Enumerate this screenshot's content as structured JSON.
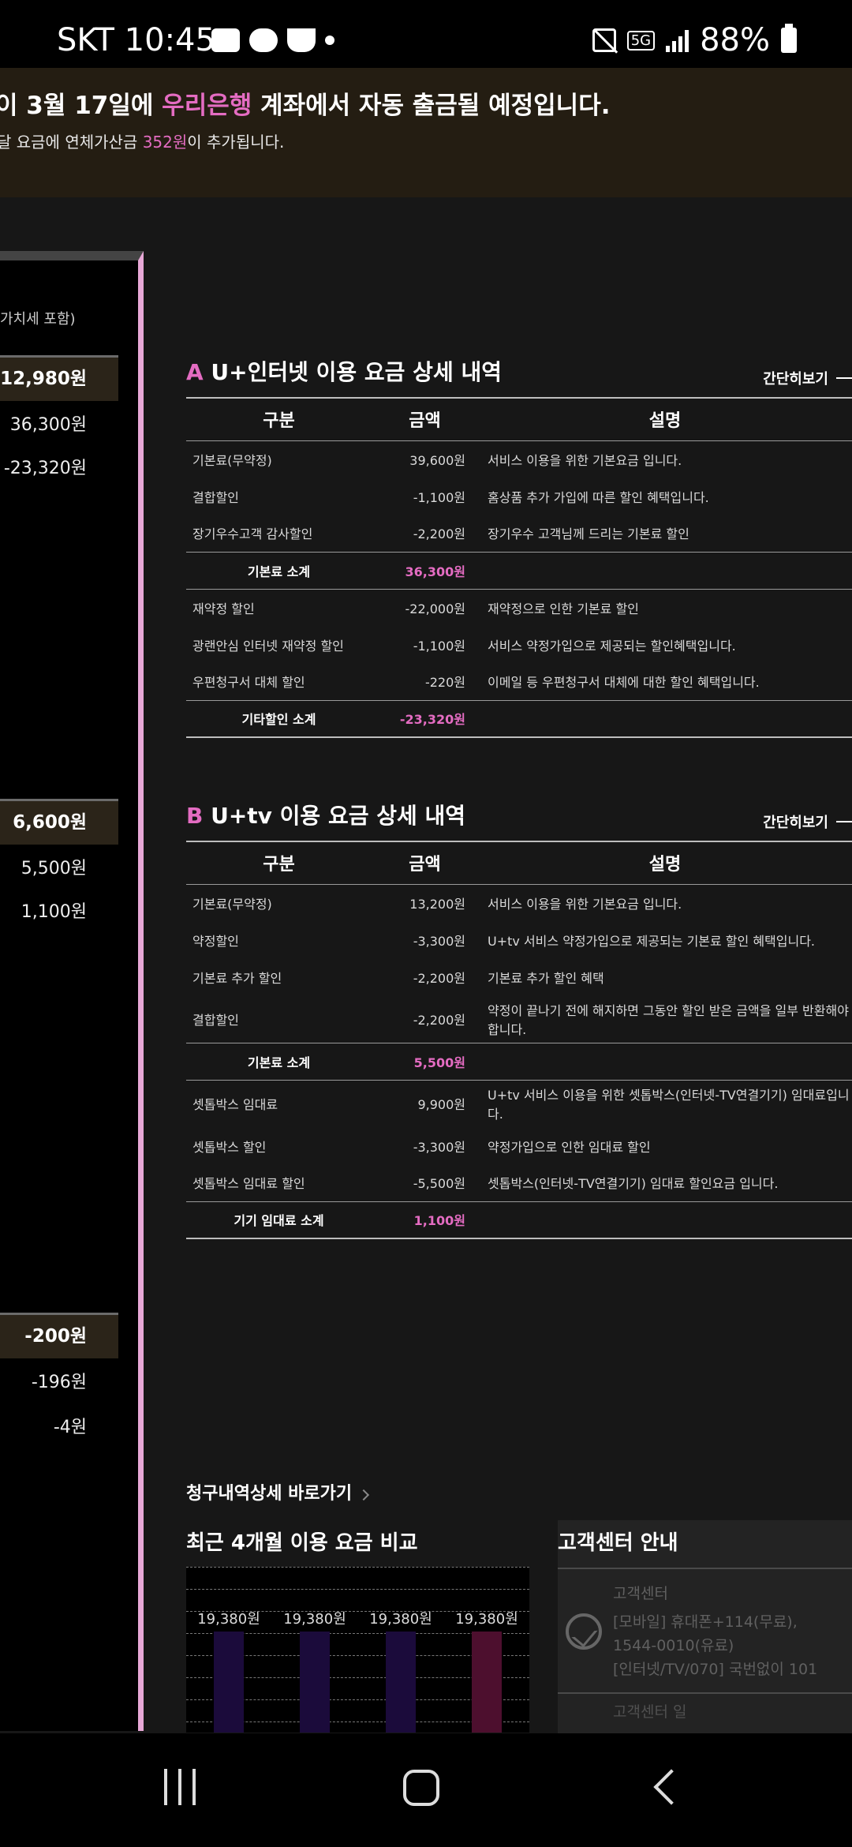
{
  "status_bar": {
    "carrier": "SKT",
    "time": "10:45",
    "network": "5G",
    "battery": "88%"
  },
  "notice": {
    "line1_pre": "이 3월 17일에 ",
    "bank": "우리은행",
    "line1_post": " 계좌에서 자동 출금될 예정입니다.",
    "line2_pre": "달 요금에 연체가산금 ",
    "late_fee": "352원",
    "line2_post": "이 추가됩니다."
  },
  "summary": {
    "vat_note": "가치세 포함)",
    "internet": {
      "total": "12,980원",
      "rows": [
        "36,300원",
        "-23,320원"
      ]
    },
    "tv": {
      "total": "6,600원",
      "rows": [
        "5,500원",
        "1,100원"
      ]
    },
    "other": {
      "total": "-200원",
      "rows": [
        "-196원",
        "-4원"
      ]
    }
  },
  "columns": {
    "category": "구분",
    "amount": "금액",
    "description": "설명"
  },
  "toggle_label": "간단히보기",
  "internet_section": {
    "letter": "A",
    "title": " U+인터넷 이용 요금 상세 내역",
    "rows": [
      {
        "name": "기본료(무약정)",
        "amount": "39,600원",
        "desc": "서비스 이용을 위한 기본요금 입니다."
      },
      {
        "name": "결합할인",
        "amount": "-1,100원",
        "desc": "홈상품 추가 가입에 따른 할인 혜택입니다."
      },
      {
        "name": "장기우수고객 감사할인",
        "amount": "-2,200원",
        "desc": "장기우수 고객님께 드리는 기본료 할인"
      },
      {
        "name": "기본료 소계",
        "amount": "36,300원",
        "desc": ""
      },
      {
        "name": "재약정 할인",
        "amount": "-22,000원",
        "desc": "재약정으로 인한 기본료 할인"
      },
      {
        "name": "광랜안심 인터넷 재약정 할인",
        "amount": "-1,100원",
        "desc": "서비스 약정가입으로 제공되는 할인혜택입니다."
      },
      {
        "name": "우편청구서 대체 할인",
        "amount": "-220원",
        "desc": "이메일 등 우편청구서 대체에 대한 할인 혜택입니다."
      },
      {
        "name": "기타할인 소계",
        "amount": "-23,320원",
        "desc": ""
      }
    ]
  },
  "tv_section": {
    "letter": "B",
    "title": " U+tv 이용 요금 상세 내역",
    "rows": [
      {
        "name": "기본료(무약정)",
        "amount": "13,200원",
        "desc": "서비스 이용을 위한 기본요금 입니다."
      },
      {
        "name": "약정할인",
        "amount": "-3,300원",
        "desc": "U+tv 서비스 약정가입으로 제공되는 기본료 할인 혜택입니다."
      },
      {
        "name": "기본료 추가 할인",
        "amount": "-2,200원",
        "desc": "기본료 추가 할인 혜택"
      },
      {
        "name": "결합할인",
        "amount": "-2,200원",
        "desc": "약정이 끝나기 전에 해지하면 그동안 할인 받은 금액을 일부 반환해야 합니다."
      },
      {
        "name": "기본료 소계",
        "amount": "5,500원",
        "desc": ""
      },
      {
        "name": "셋톱박스 임대료",
        "amount": "9,900원",
        "desc": "U+tv 서비스 이용을 위한 셋톱박스(인터넷-TV연결기기) 임대료입니다."
      },
      {
        "name": "셋톱박스 할인",
        "amount": "-3,300원",
        "desc": "약정가입으로 인한 임대료 할인"
      },
      {
        "name": "셋톱박스 임대료 할인",
        "amount": "-5,500원",
        "desc": "셋톱박스(인터넷-TV연결기기) 임대료 할인요금 입니다."
      },
      {
        "name": "기기 임대료 소계",
        "amount": "1,100원",
        "desc": ""
      }
    ]
  },
  "bill_detail_link": "청구내역상세 바로가기",
  "comparison": {
    "title": "최근 4개월 이용 요금 비교",
    "bars": [
      {
        "label": "19,380원",
        "value": 19380,
        "color": "#1b0b3b"
      },
      {
        "label": "19,380원",
        "value": 19380,
        "color": "#1b0b3b"
      },
      {
        "label": "19,380원",
        "value": 19380,
        "color": "#1b0b3b"
      },
      {
        "label": "19,380원",
        "value": 19380,
        "color": "#4d0f2e"
      }
    ]
  },
  "customer_center": {
    "title": "고객센터 안내",
    "heading": "고객센터",
    "line1": "[모바일] 휴대폰+114(무료),",
    "line2": "1544-0010(유료)",
    "line3": "[인터넷/TV/070] 국번없이 101",
    "next": "고객센터 일"
  }
}
